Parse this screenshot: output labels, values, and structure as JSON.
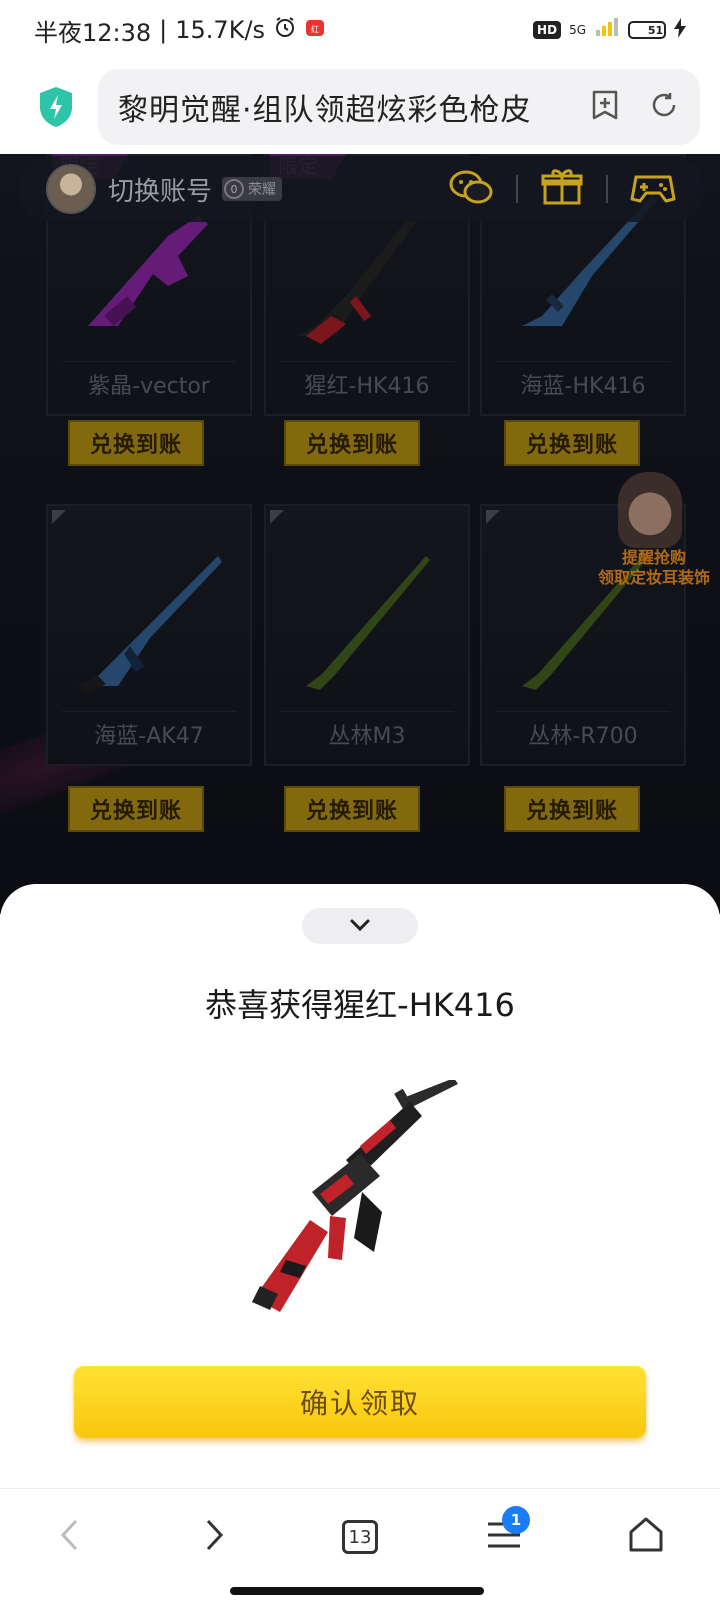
{
  "status_bar": {
    "time": "半夜12:38",
    "speed": "15.7K/s",
    "hd": "HD",
    "network": "5G",
    "battery": "51"
  },
  "browser": {
    "url_title": "黎明觉醒·组队领超炫彩色枪皮"
  },
  "account": {
    "switch_label": "切换账号",
    "rank_value": "0",
    "rank_label": "荣耀"
  },
  "weapons": [
    {
      "name": "紫晶-vector",
      "limited": "限定",
      "color": "#9b2bb8"
    },
    {
      "name": "猩红-HK416",
      "limited": "限定",
      "color": "#c0222a"
    },
    {
      "name": "海蓝-HK416",
      "limited": "",
      "color": "#3a6ea5"
    },
    {
      "name": "海蓝-AK47",
      "limited": "",
      "color": "#3a6ea5"
    },
    {
      "name": "丛林M3",
      "limited": "",
      "color": "#4e6b22"
    },
    {
      "name": "丛林-R700",
      "limited": "",
      "color": "#4e6b22"
    }
  ],
  "redeem_label": "兑换到账",
  "side_promo": {
    "line1": "提醒抢购",
    "line2": "领取定妆耳装饰"
  },
  "sheet": {
    "title": "恭喜获得猩红-HK416",
    "confirm_label": "确认领取"
  },
  "nav": {
    "tab_count": "13",
    "menu_badge": "1"
  },
  "colors": {
    "accent_yellow": "#f9c60e",
    "badge_blue": "#1a7cf6",
    "shield_teal": "#2ec4a9"
  }
}
